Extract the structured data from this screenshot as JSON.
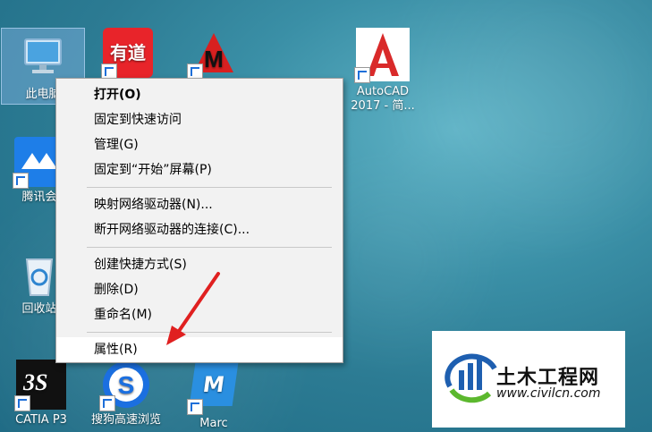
{
  "desktop": {
    "icons": [
      {
        "label": "此电脑",
        "name": "this-pc"
      },
      {
        "label": "",
        "name": "youdao"
      },
      {
        "label": "",
        "name": "m-app"
      },
      {
        "label": "AutoCAD 2017 - 简...",
        "name": "autocad"
      },
      {
        "label": "腾讯会",
        "name": "tencent-meeting"
      },
      {
        "label": "回收站",
        "name": "recycle-bin"
      },
      {
        "label": "CATIA P3",
        "name": "catia"
      },
      {
        "label": "搜狗高速浏览",
        "name": "sogou-browser"
      },
      {
        "label": "Marc",
        "name": "marc"
      }
    ]
  },
  "context_menu": {
    "items": [
      {
        "label": "打开(O)"
      },
      {
        "label": "固定到快速访问"
      },
      {
        "label": "管理(G)"
      },
      {
        "label": "固定到“开始”屏幕(P)"
      },
      {
        "label": "映射网络驱动器(N)..."
      },
      {
        "label": "断开网络驱动器的连接(C)..."
      },
      {
        "label": "创建快捷方式(S)"
      },
      {
        "label": "删除(D)"
      },
      {
        "label": "重命名(M)"
      },
      {
        "label": "属性(R)"
      }
    ]
  },
  "watermark": {
    "brand": "土木工程网",
    "url": "www.civilcn.com"
  },
  "colors": {
    "accent_red": "#e02020",
    "logo_blue": "#1e5fb0",
    "logo_green": "#5cb82e"
  }
}
